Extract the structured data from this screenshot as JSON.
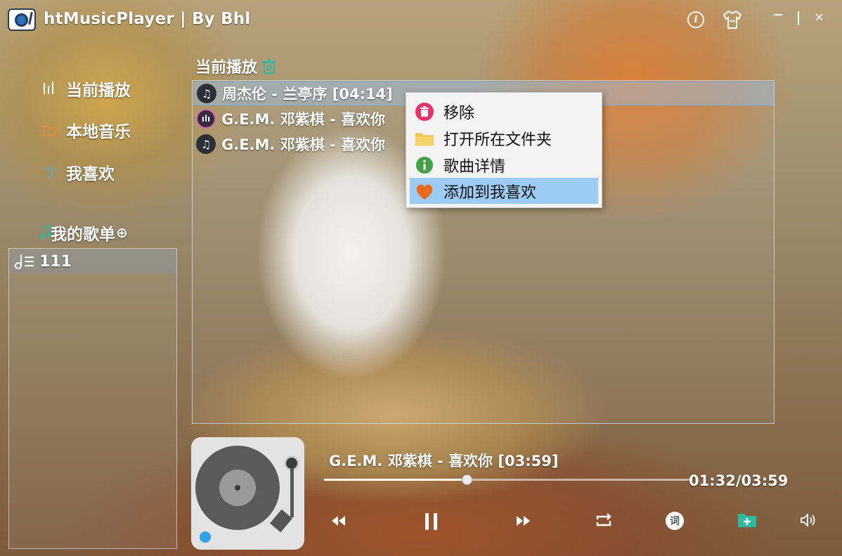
{
  "window": {
    "title": "htMusicPlayer | By Bhl",
    "close_glyph": "×"
  },
  "sidebar": {
    "items": [
      {
        "label": "当前播放",
        "icon": "bars-icon"
      },
      {
        "label": "本地音乐",
        "icon": "folder-icon"
      },
      {
        "label": "我喜欢",
        "icon": "heart-icon"
      }
    ],
    "playlists_title": "我的歌单",
    "add_glyph": "⊕",
    "playlists": [
      {
        "name": "111"
      }
    ]
  },
  "main": {
    "section_title": "当前播放",
    "songs": [
      {
        "title": "周杰伦 - 兰亭序 [04:14]",
        "state": "selected",
        "icon_glyph": "♫"
      },
      {
        "title": "G.E.M. 邓紫棋 - 喜欢你",
        "state": "playing",
        "icon_glyph": "ılı"
      },
      {
        "title": "G.E.M. 邓紫棋 - 喜欢你",
        "state": "normal",
        "icon_glyph": "♫"
      }
    ]
  },
  "context_menu": {
    "items": [
      {
        "label": "移除",
        "icon": "trash-icon"
      },
      {
        "label": "打开所在文件夹",
        "icon": "folder-open-icon"
      },
      {
        "label": "歌曲详情",
        "icon": "info-icon"
      },
      {
        "label": "添加到我喜欢",
        "icon": "heart-icon",
        "hover": true
      }
    ]
  },
  "player": {
    "now_playing": "G.E.M. 邓紫棋 - 喜欢你 [03:59]",
    "time": "01:32/03:59",
    "progress": 0.39,
    "lyrics_label": "词"
  },
  "colors": {
    "accent_teal": "#2fb8a0",
    "menu_hover": "#9ccbf3",
    "menu_bg": "#f3f3f3"
  }
}
